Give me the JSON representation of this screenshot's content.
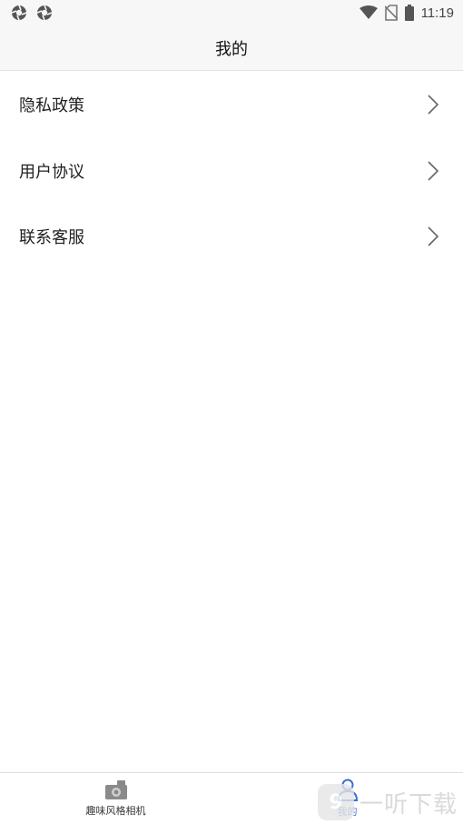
{
  "status_bar": {
    "time": "11:19",
    "icons": [
      "aperture-icon",
      "aperture-icon",
      "wifi-icon",
      "no-sim-icon",
      "battery-icon"
    ]
  },
  "header": {
    "title": "我的"
  },
  "menu": {
    "items": [
      {
        "label": "隐私政策",
        "icon": "chevron-right-icon"
      },
      {
        "label": "用户协议",
        "icon": "chevron-right-icon"
      },
      {
        "label": "联系客服",
        "icon": "chevron-right-icon"
      }
    ]
  },
  "tab_bar": {
    "tabs": [
      {
        "label": "趣味风格相机",
        "icon": "camera-icon",
        "active": false
      },
      {
        "label": "我的",
        "icon": "user-icon",
        "active": true
      }
    ]
  },
  "watermark": {
    "badge": "9",
    "text": "一听下载"
  },
  "colors": {
    "accent": "#3a6bd8",
    "header_bg": "#f7f7f7",
    "divider": "#e2e2e2"
  }
}
